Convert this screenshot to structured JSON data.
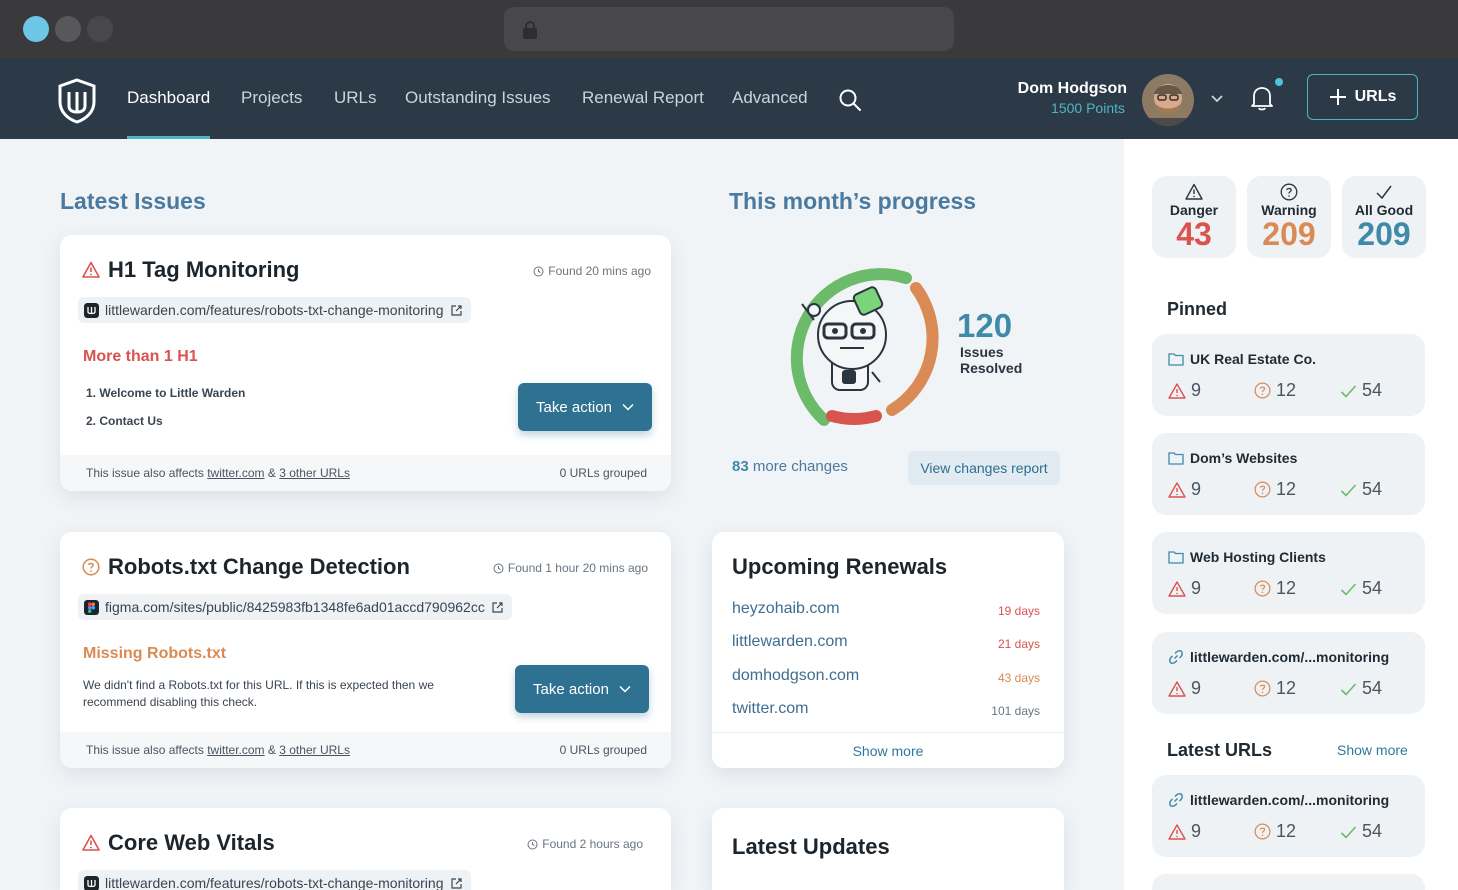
{
  "nav": {
    "items": [
      "Dashboard",
      "Projects",
      "URLs",
      "Outstanding Issues",
      "Renewal Report",
      "Advanced"
    ],
    "user_name": "Dom Hodgson",
    "user_points": "1500 Points",
    "add_button": "URLs"
  },
  "latest_issues": {
    "title": "Latest Issues",
    "cards": [
      {
        "title": "H1 Tag Monitoring",
        "found": "Found 20 mins ago",
        "url": "littlewarden.com/features/robots-txt-change-monitoring",
        "severity": "danger",
        "subheading": "More than 1 H1",
        "lines": [
          "1. Welcome to Little Warden",
          "2. Contact Us"
        ],
        "action": "Take action",
        "footer_prefix": "This issue also affects",
        "footer_link1": "twitter.com",
        "footer_amp": "&",
        "footer_link2": "3 other URLs",
        "grouped": "0 URLs grouped"
      },
      {
        "title": "Robots.txt Change Detection",
        "found": "Found 1 hour 20 mins ago",
        "url": "figma.com/sites/public/8425983fb1348fe6ad01accd790962cc",
        "severity": "warning",
        "subheading": "Missing Robots.txt",
        "description": "We didn't find a Robots.txt for this URL. If this is expected then we recommend disabling this check.",
        "action": "Take action",
        "footer_prefix": "This issue also affects",
        "footer_link1": "twitter.com",
        "footer_amp": "&",
        "footer_link2": "3 other URLs",
        "grouped": "0 URLs grouped"
      },
      {
        "title": "Core Web Vitals",
        "found": "Found 2 hours ago",
        "url": "littlewarden.com/features/robots-txt-change-monitoring",
        "severity": "danger"
      }
    ]
  },
  "progress": {
    "title": "This month’s progress",
    "resolved_count": "120",
    "resolved_label_1": "Issues",
    "resolved_label_2": "Resolved",
    "more_count": "83",
    "more_label": "more changes",
    "report_button": "View changes report"
  },
  "renewals": {
    "title": "Upcoming Renewals",
    "rows": [
      {
        "domain": "heyzohaib.com",
        "days": "19 days",
        "color": "#d9534f"
      },
      {
        "domain": "littlewarden.com",
        "days": "21 days",
        "color": "#d9534f"
      },
      {
        "domain": "domhodgson.com",
        "days": "43 days",
        "color": "#d98a55"
      },
      {
        "domain": "twitter.com",
        "days": "101 days",
        "color": "#6a7580"
      }
    ],
    "show_more": "Show more"
  },
  "updates": {
    "title": "Latest Updates"
  },
  "stats": [
    {
      "label": "Danger",
      "value": "43",
      "color": "#d9534f"
    },
    {
      "label": "Warning",
      "value": "209",
      "color": "#d98a55"
    },
    {
      "label": "All Good",
      "value": "209",
      "color": "#3f8aa8"
    }
  ],
  "pinned": {
    "title": "Pinned",
    "items": [
      {
        "name": "UK Real Estate Co.",
        "icon": "folder-icon",
        "danger": "9",
        "warning": "12",
        "good": "54"
      },
      {
        "name": "Dom’s Websites",
        "icon": "folder-icon",
        "danger": "9",
        "warning": "12",
        "good": "54"
      },
      {
        "name": "Web Hosting Clients",
        "icon": "folder-icon",
        "danger": "9",
        "warning": "12",
        "good": "54"
      },
      {
        "name": "littlewarden.com/...monitoring",
        "icon": "link-icon",
        "danger": "9",
        "warning": "12",
        "good": "54"
      }
    ]
  },
  "latest_urls": {
    "title": "Latest URLs",
    "show_more": "Show more",
    "items": [
      {
        "name": "littlewarden.com/...monitoring",
        "icon": "link-icon",
        "danger": "9",
        "warning": "12",
        "good": "54"
      }
    ]
  },
  "colors": {
    "danger": "#d9534f",
    "warning": "#d98a55",
    "good": "#3f8aa8",
    "nav_bg": "#2c3a48",
    "accent": "#4fb3c4",
    "button": "#2f7191"
  }
}
